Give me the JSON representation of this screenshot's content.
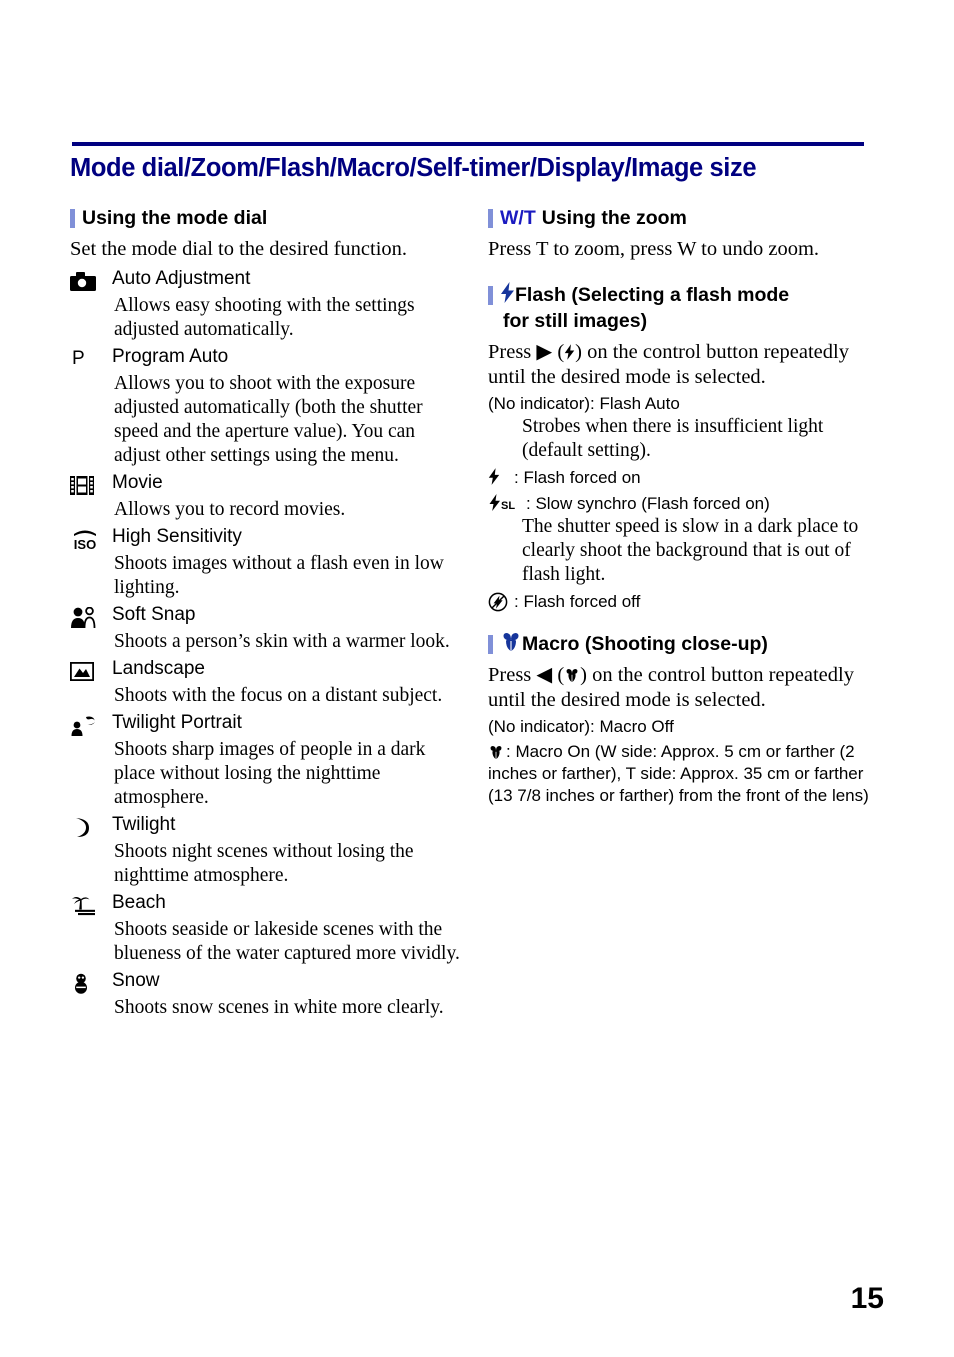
{
  "document": {
    "chapter_title": "Mode dial/Zoom/Flash/Macro/Self-timer/Display/Image size",
    "page_number": "15",
    "accent_color": "#000080",
    "bar_color": "#8090d8",
    "heading_accent_color": "#1a1ac0"
  },
  "left_column": {
    "mode_dial_section": {
      "heading": "Using the mode dial",
      "intro": "Set the mode dial to the desired function.",
      "items": [
        {
          "icon": "camera-icon",
          "icon_kind": "svg",
          "label": "Auto Adjustment",
          "description": "Allows easy shooting with the settings adjusted automatically."
        },
        {
          "icon": "letter-p-icon",
          "icon_kind": "text",
          "icon_text": "P",
          "label": "Program Auto",
          "description": "Allows you to shoot with the exposure adjusted automatically (both the shutter speed and the aperture value). You can adjust other settings using the menu."
        },
        {
          "icon": "film-strip-icon",
          "icon_kind": "svg",
          "label": "Movie",
          "description": "Allows you to record movies."
        },
        {
          "icon": "iso-high-sensitivity-icon",
          "icon_kind": "svg",
          "label": "High Sensitivity",
          "description": "Shoots images without a flash even in low lighting."
        },
        {
          "icon": "soft-snap-people-icon",
          "icon_kind": "svg",
          "label": "Soft Snap",
          "description": "Shoots a person’s skin with a warmer look."
        },
        {
          "icon": "landscape-mountain-icon",
          "icon_kind": "svg",
          "label": "Landscape",
          "description": "Shoots with the focus on a distant subject."
        },
        {
          "icon": "twilight-portrait-icon",
          "icon_kind": "svg",
          "label": "Twilight Portrait",
          "description": "Shoots sharp images of people in a dark place without losing the nighttime atmosphere."
        },
        {
          "icon": "crescent-moon-icon",
          "icon_kind": "svg",
          "label": "Twilight",
          "description": "Shoots night scenes without losing the nighttime atmosphere."
        },
        {
          "icon": "palm-tree-beach-icon",
          "icon_kind": "svg",
          "label": "Beach",
          "description": "Shoots seaside or lakeside scenes with the blueness of the water captured more vividly."
        },
        {
          "icon": "snowman-icon",
          "icon_kind": "svg",
          "label": "Snow",
          "description": "Shoots snow scenes in white more clearly."
        }
      ]
    }
  },
  "right_column": {
    "zoom_section": {
      "heading_accent": "W/T",
      "heading": "Using the zoom",
      "body": "Press T to zoom, press W to undo zoom."
    },
    "flash_section": {
      "heading_line1": "Flash (Selecting a flash mode",
      "heading_line2": "for still images)",
      "heading_icon": "flash-bolt-icon",
      "instruction_prefix": "Press",
      "instruction_arrow": "▶",
      "instruction_suffix": ") on the control button repeatedly until the desired mode is selected.",
      "no_indicator_line": "(No indicator): Flash Auto",
      "no_indicator_desc": "Strobes when there is insufficient light (default setting).",
      "modes": [
        {
          "icon": "flash-bolt-icon",
          "text": ": Flash forced on"
        },
        {
          "icon": "flash-slow-synchro-icon",
          "text": ": Slow synchro (Flash forced on)",
          "description": "The shutter speed is slow in a dark place to clearly shoot the background that is out of flash light."
        },
        {
          "icon": "flash-off-icon",
          "text": ": Flash forced off"
        }
      ]
    },
    "macro_section": {
      "heading": "Macro (Shooting close-up)",
      "heading_icon": "macro-tulip-icon",
      "instruction_prefix": "Press",
      "instruction_arrow": "◀",
      "instruction_suffix": ") on the control button repeatedly until the desired mode is selected.",
      "no_indicator_line": "(No indicator): Macro Off",
      "macro_on_text": ": Macro On (W side: Approx. 5 cm or farther (2 inches or farther), T side: Approx. 35 cm or farther (13 7/8 inches or farther) from the front of the lens)"
    }
  }
}
